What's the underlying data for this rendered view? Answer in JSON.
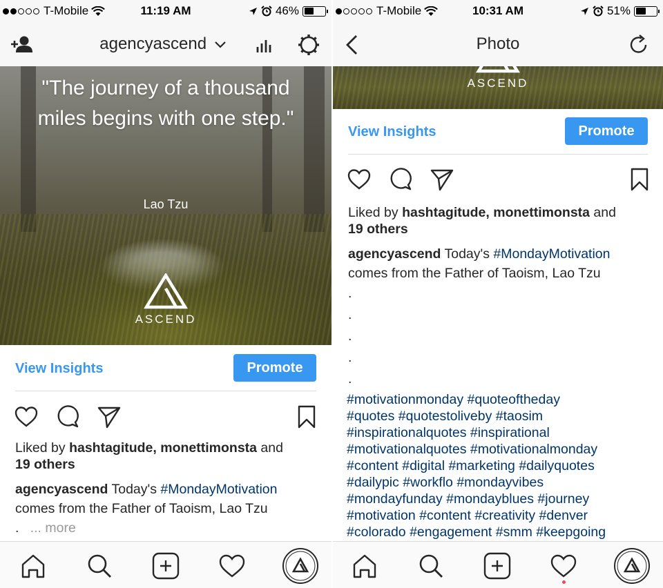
{
  "left": {
    "status": {
      "carrier": "T-Mobile",
      "time": "11:19 AM",
      "battery": "46%",
      "battery_level": 0.46
    },
    "nav": {
      "username": "agencyascend"
    },
    "post_image": {
      "quote": "\"The journey of a thousand miles begins with one step.\"",
      "author": "Lao Tzu",
      "logo_text": "ASCEND"
    },
    "insights": {
      "view_label": "View Insights",
      "promote_label": "Promote"
    },
    "likes": {
      "prefix": "Liked by ",
      "users": "hashtagitude, monettimonsta",
      "and": " and",
      "others": "19 others"
    },
    "caption": {
      "user": "agencyascend",
      "before": " Today's ",
      "hashtag": "#MondayMotivation",
      "after": "comes from the Father of Taoism, Lao Tzu",
      "dot": ".",
      "more": "... more"
    }
  },
  "right": {
    "status": {
      "carrier": "T-Mobile",
      "time": "10:31 AM",
      "battery": "51%",
      "battery_level": 0.51
    },
    "nav": {
      "title": "Photo"
    },
    "post_image": {
      "logo_text": "ASCEND"
    },
    "insights": {
      "view_label": "View Insights",
      "promote_label": "Promote"
    },
    "likes": {
      "prefix": "Liked by ",
      "users": "hashtagitude, monettimonsta",
      "and": " and",
      "others": "19 others"
    },
    "caption": {
      "user": "agencyascend",
      "before": " Today's ",
      "hashtag": "#MondayMotivation",
      "after": "comes from the Father of Taoism, Lao Tzu",
      "dots": [
        ".",
        ".",
        ".",
        ".",
        "."
      ],
      "hashtag_lines": [
        "#motivationmonday #quoteoftheday",
        "#quotes #quotestoliveby #taosim",
        "#inspirationalquotes #inspirational",
        "#motivationalquotes #motivationalmonday",
        "#content #digital #marketing #dailyquotes",
        "#dailypic #workflo #mondayvibes",
        "#mondayfunday #mondayblues #journey",
        "#motivation #content #creativity #denver",
        "#colorado #engagement #smm #keepgoing"
      ]
    }
  },
  "icons": {
    "left_nav": [
      "add-user-icon",
      "chevron-down-icon",
      "insights-bar-chart-icon",
      "settings-gear-icon"
    ],
    "right_nav": [
      "back-chevron-icon",
      "refresh-icon"
    ],
    "actions": [
      "heart-icon",
      "comment-icon",
      "share-icon",
      "bookmark-icon"
    ],
    "tabs": [
      "home-icon",
      "search-icon",
      "add-post-icon",
      "activity-heart-icon",
      "profile-avatar-icon"
    ]
  },
  "colors": {
    "accent": "#3897f0",
    "hashtag": "#003569",
    "notification": "#ed4956"
  }
}
